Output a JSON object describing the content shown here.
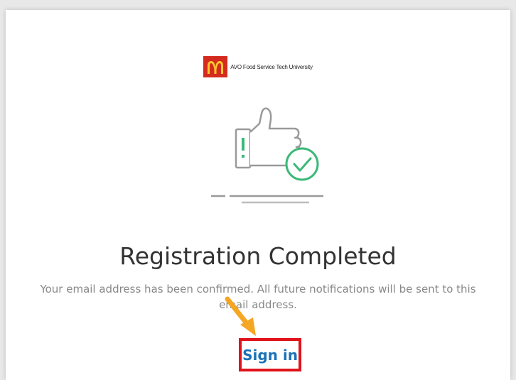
{
  "brand": {
    "logo_icon": "golden-arches-logo",
    "name": "AVO Food Service Tech University",
    "logo_color": "#d52b1e",
    "arches_color": "#ffc72c"
  },
  "illustration": {
    "icon": "thumbs-up-check-icon",
    "check_color": "#3cb878"
  },
  "title": "Registration Completed",
  "message": "Your email address has been confirmed. All future notifications will be sent to this email address.",
  "signin": {
    "label": "Sign in",
    "link_color": "#1a72b8",
    "highlight_color": "#e0131a"
  },
  "annotation": {
    "arrow_color": "#f5a623"
  }
}
